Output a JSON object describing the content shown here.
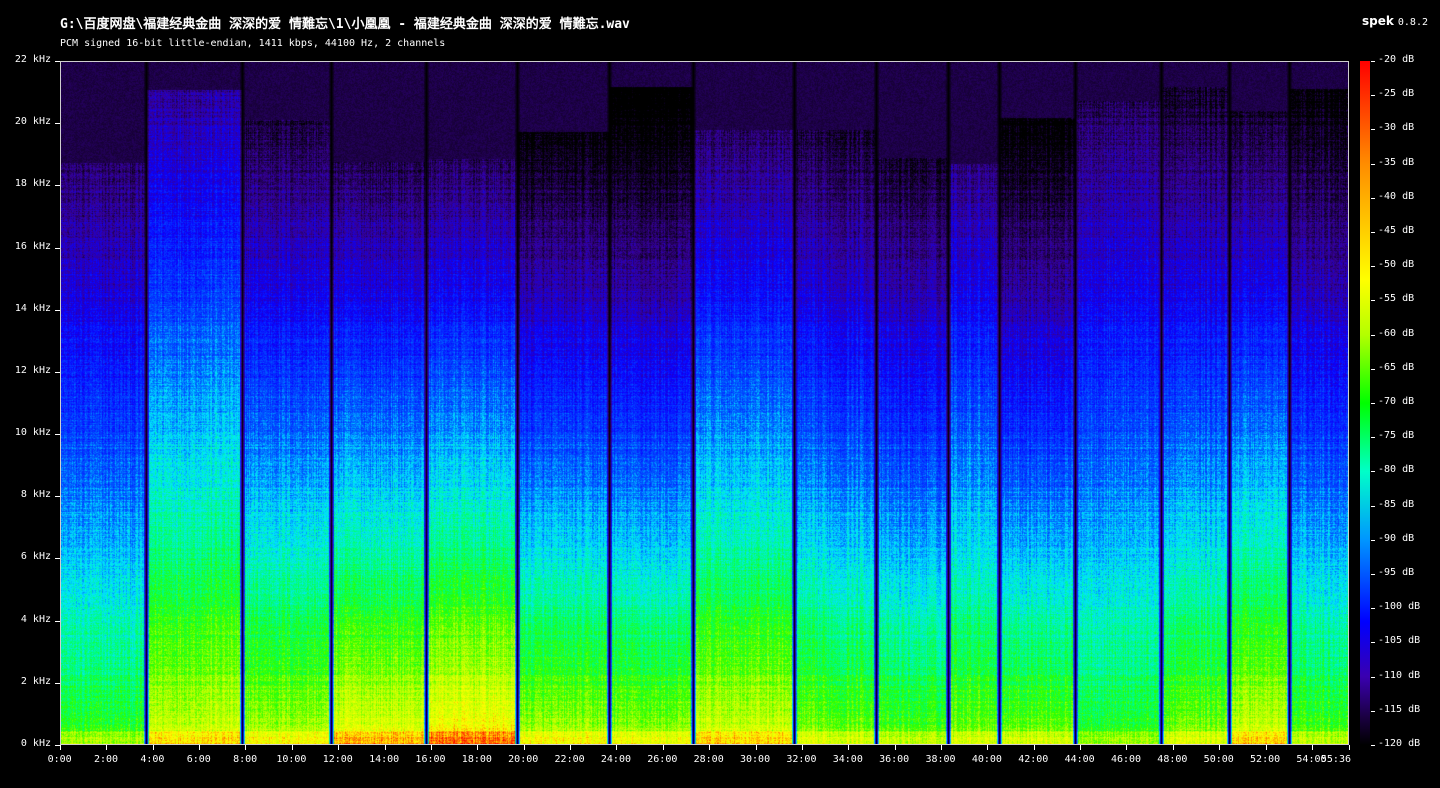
{
  "window": {
    "title": "G:\\百度网盘\\福建经典金曲 深深的爱 情難忘\\1\\小凰凰 - 福建经典金曲 深深的爱 情難忘.wav",
    "subtitle": "PCM signed 16-bit little-endian, 1411 kbps, 44100 Hz, 2 channels",
    "app_name": "spek",
    "app_version": "0.8.2"
  },
  "y_axis": {
    "unit": "kHz",
    "ticks": [
      "0 kHz",
      "2 kHz",
      "4 kHz",
      "6 kHz",
      "8 kHz",
      "10 kHz",
      "12 kHz",
      "14 kHz",
      "16 kHz",
      "18 kHz",
      "20 kHz",
      "22 kHz"
    ],
    "min": 0,
    "max": 22
  },
  "x_axis": {
    "ticks": [
      "0:00",
      "2:00",
      "4:00",
      "6:00",
      "8:00",
      "10:00",
      "12:00",
      "14:00",
      "16:00",
      "18:00",
      "20:00",
      "22:00",
      "24:00",
      "26:00",
      "28:00",
      "30:00",
      "32:00",
      "34:00",
      "36:00",
      "38:00",
      "40:00",
      "42:00",
      "44:00",
      "46:00",
      "48:00",
      "50:00",
      "52:00",
      "54:00",
      "55:36"
    ],
    "duration_seconds": 3336
  },
  "color_scale": {
    "ticks": [
      "-20 dB",
      "-25 dB",
      "-30 dB",
      "-35 dB",
      "-40 dB",
      "-45 dB",
      "-50 dB",
      "-55 dB",
      "-60 dB",
      "-65 dB",
      "-70 dB",
      "-75 dB",
      "-80 dB",
      "-85 dB",
      "-90 dB",
      "-95 dB",
      "-100 dB",
      "-105 dB",
      "-110 dB",
      "-115 dB",
      "-120 dB"
    ],
    "max_db": -20,
    "min_db": -120
  },
  "track_breaks_seconds": [
    220,
    468,
    701,
    947,
    1183,
    1421,
    1639,
    1900,
    2112,
    2300,
    2432,
    2628,
    2852,
    3028,
    3184
  ]
}
